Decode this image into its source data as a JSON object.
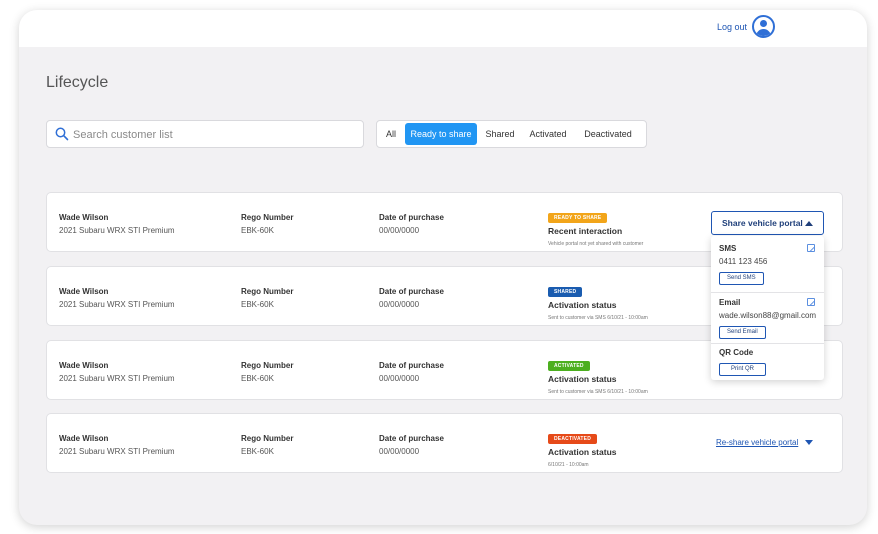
{
  "header": {
    "logout_label": "Log out"
  },
  "page": {
    "title": "Lifecycle"
  },
  "search": {
    "placeholder": "Search customer list"
  },
  "filters": [
    "All",
    "Ready to share",
    "Shared",
    "Activated",
    "Deactivated"
  ],
  "active_filter": "Ready to share",
  "customers": [
    {
      "name": "Wade Wilson",
      "vehicle": "2021 Subaru WRX STI Premium",
      "rego_label": "Rego Number",
      "rego": "EBK-60K",
      "date_label": "Date of purchase",
      "date": "00/00/0000",
      "badge": "READY TO SHARE",
      "badge_color": "#f2a51a",
      "status_title": "Recent interaction",
      "status_sub": "Vehicle portal not yet shared with customer"
    },
    {
      "name": "Wade Wilson",
      "vehicle": "2021 Subaru WRX STI Premium",
      "rego_label": "Rego Number",
      "rego": "EBK-60K",
      "date_label": "Date of purchase",
      "date": "00/00/0000",
      "badge": "SHARED",
      "badge_color": "#1a5cb0",
      "status_title": "Activation status",
      "status_sub": "Sent to customer via SMS 6/10/21 - 10:00am"
    },
    {
      "name": "Wade Wilson",
      "vehicle": "2021 Subaru WRX STI Premium",
      "rego_label": "Rego Number",
      "rego": "EBK-60K",
      "date_label": "Date of purchase",
      "date": "00/00/0000",
      "badge": "ACTIVATED",
      "badge_color": "#4caf1f",
      "status_title": "Activation status",
      "status_sub": "Sent to customer via SMS 6/10/21 - 10:00am"
    },
    {
      "name": "Wade Wilson",
      "vehicle": "2021 Subaru WRX STI Premium",
      "rego_label": "Rego Number",
      "rego": "EBK-60K",
      "date_label": "Date of purchase",
      "date": "00/00/0000",
      "badge": "DEACTIVATED",
      "badge_color": "#e64a19",
      "status_title": "Activation status",
      "status_sub": "6/10/21 - 10:00am"
    }
  ],
  "share_menu": {
    "button_label": "Share vehicle portal",
    "sms_title": "SMS",
    "sms_value": "0411 123 456",
    "sms_button": "Send SMS",
    "email_title": "Email",
    "email_value": "wade.wilson88@gmail.com",
    "email_button": "Send Email",
    "qr_title": "QR Code",
    "qr_button": "Print QR"
  },
  "reshare_label": "Re-share vehicle portal",
  "colors": {
    "accent": "#2196f3",
    "link": "#1f56b3"
  }
}
